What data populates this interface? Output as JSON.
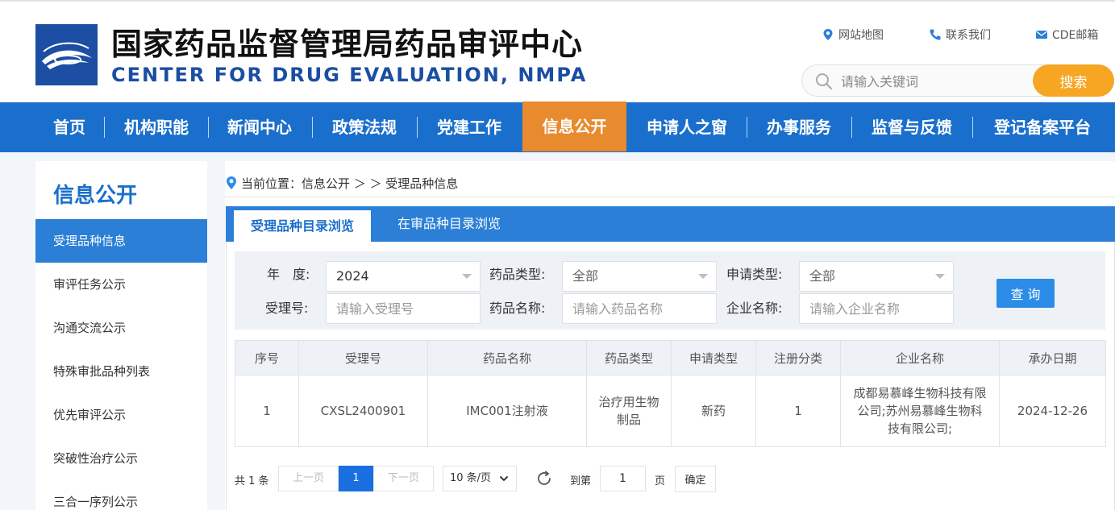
{
  "header": {
    "title_cn": "国家药品监督管理局药品审评中心",
    "title_en": "CENTER FOR DRUG EVALUATION, NMPA",
    "links": [
      {
        "label": "网站地图",
        "icon": "location-pin-icon"
      },
      {
        "label": "联系我们",
        "icon": "phone-icon"
      },
      {
        "label": "CDE邮箱",
        "icon": "mail-icon"
      }
    ],
    "search_placeholder": "请输入关键词",
    "search_button": "搜索"
  },
  "colors": {
    "brand_blue": "#1a6fcc",
    "active_orange": "#e88a2e",
    "search_orange": "#f6a623",
    "tab_blue": "#2b7fd6",
    "page_current": "#1a6fe0"
  },
  "nav": {
    "items": [
      "首页",
      "机构职能",
      "新闻中心",
      "政策法规",
      "党建工作",
      "信息公开",
      "申请人之窗",
      "办事服务",
      "监督与反馈",
      "登记备案平台"
    ],
    "active": "信息公开"
  },
  "sidebar": {
    "title": "信息公开",
    "items": [
      "受理品种信息",
      "审评任务公示",
      "沟通交流公示",
      "特殊审批品种列表",
      "优先审评公示",
      "突破性治疗公示",
      "三合一序列公示"
    ],
    "active": "受理品种信息"
  },
  "breadcrumb": {
    "text": "当前位置：信息公开 ＞ ＞ 受理品种信息"
  },
  "tabs": {
    "items": [
      "受理品种目录浏览",
      "在审品种目录浏览"
    ],
    "active": "受理品种目录浏览"
  },
  "filters": {
    "year_label": "年　度:",
    "year_value": "2024",
    "drug_type_label": "药品类型:",
    "drug_type_value": "全部",
    "apply_type_label": "申请类型:",
    "apply_type_value": "全部",
    "accept_no_label": "受理号:",
    "accept_no_placeholder": "请输入受理号",
    "drug_name_label": "药品名称:",
    "drug_name_placeholder": "请输入药品名称",
    "company_label": "企业名称:",
    "company_placeholder": "请输入企业名称",
    "query_button": "查 询"
  },
  "table": {
    "headers": [
      "序号",
      "受理号",
      "药品名称",
      "药品类型",
      "申请类型",
      "注册分类",
      "企业名称",
      "承办日期"
    ],
    "rows": [
      [
        "1",
        "CXSL2400901",
        "IMC001注射液",
        "治疗用生物制品",
        "新药",
        "1",
        "成都易慕峰生物科技有限公司;苏州易慕峰生物科技有限公司;",
        "2024-12-26"
      ]
    ]
  },
  "pagination": {
    "total": "共 1 条",
    "prev": "上一页",
    "current": "1",
    "next": "下一页",
    "page_size": "10 条/页",
    "goto_label": "到第",
    "goto_value": "1",
    "page_unit": "页",
    "confirm": "确定"
  }
}
